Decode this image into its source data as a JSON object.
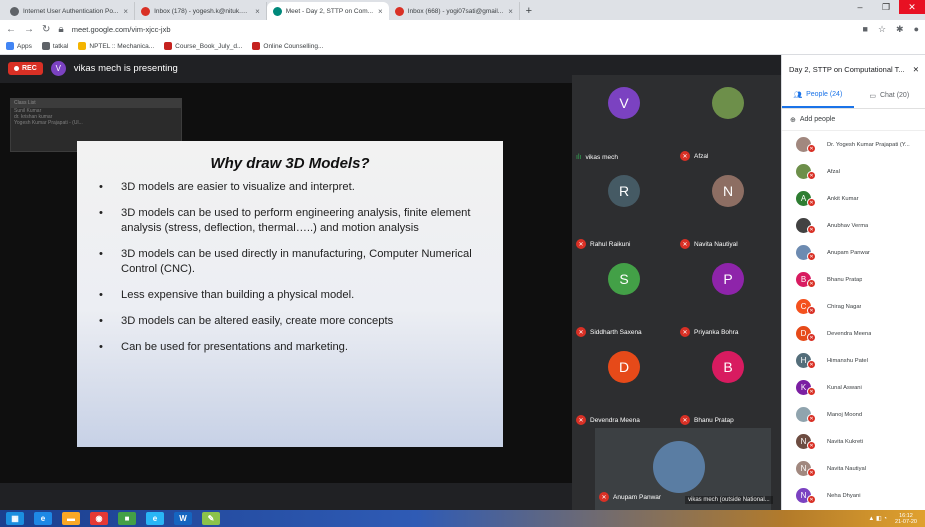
{
  "browser": {
    "tabs": [
      {
        "title": "Internet User Authentication Po...",
        "icon_color": "#5f6368",
        "active": false
      },
      {
        "title": "Inbox (178) - yogesh.k@nituk.ac...",
        "icon_color": "#d93025",
        "active": false
      },
      {
        "title": "Meet - Day 2, STTP on Com...",
        "icon_color": "#00897b",
        "active": true
      },
      {
        "title": "Inbox (668) - yogi07sati@gmail...",
        "icon_color": "#d93025",
        "active": false
      }
    ],
    "new_tab": "+",
    "url": "meet.google.com/vim-xjcc-jxb",
    "bookmarks": [
      {
        "label": "Apps",
        "color": "#4285f4"
      },
      {
        "label": "tatkal",
        "color": "#5f6368"
      },
      {
        "label": "NPTEL :: Mechanica...",
        "color": "#f4b400"
      },
      {
        "label": "Course_Book_July_d...",
        "color": "#c5221f"
      },
      {
        "label": "Online Counselling...",
        "color": "#c5221f"
      }
    ]
  },
  "meeting": {
    "rec_label": "REC",
    "presenter_initial": "V",
    "presenter_text": "vikas mech is presenting",
    "class_list": {
      "header": "Class List",
      "rows": [
        "Sunil Kumar",
        "dr. krishan kumar",
        "Yogesh Kumar Prajapati - (Ul..."
      ]
    },
    "slide": {
      "title": "Why draw 3D Models?",
      "bullets": [
        "3D models are easier to visualize and interpret.",
        "3D models can be used to perform engineering analysis, finite element analysis (stress, deflection, thermal…..) and motion analysis",
        "3D models can be used directly in manufacturing, Computer Numerical Control (CNC).",
        "Less expensive than building a physical model.",
        "3D models can be altered easily, create more concepts",
        "Can be used for presentations and marketing."
      ]
    },
    "tiles": [
      {
        "name": "vikas mech",
        "initial": "V",
        "color": "#7b42c1",
        "speaking": true
      },
      {
        "name": "Afzal",
        "initial": "",
        "color": "#6d8f4a",
        "speaking": false
      },
      {
        "name": "Rahul Raikuni",
        "initial": "R",
        "color": "#455a64",
        "speaking": false
      },
      {
        "name": "Navita Nautiyal",
        "initial": "N",
        "color": "#8d6e63",
        "speaking": false
      },
      {
        "name": "Siddharth Saxena",
        "initial": "S",
        "color": "#43a047",
        "speaking": false
      },
      {
        "name": "Priyanka Bohra",
        "initial": "P",
        "color": "#8e24aa",
        "speaking": false
      },
      {
        "name": "Devendra Meena",
        "initial": "D",
        "color": "#e64a19",
        "speaking": false
      },
      {
        "name": "Bhanu Pratap",
        "initial": "B",
        "color": "#d81b60",
        "speaking": false
      }
    ],
    "self_tile_name": "Anupam Panwar",
    "self_tile_label": "vikas mech (outside National..."
  },
  "panel": {
    "title": "Day 2, STTP on Computational T...",
    "tab_people": "People (24)",
    "tab_chat": "Chat (20)",
    "add_people": "Add people",
    "people": [
      {
        "name": "Dr. Yogesh Kumar Prajapati (Y...",
        "initial": "",
        "color": "#a1887f"
      },
      {
        "name": "Afzal",
        "initial": "",
        "color": "#6d8f4a"
      },
      {
        "name": "Ankit Kumar",
        "initial": "A",
        "color": "#2e7d32"
      },
      {
        "name": "Anubhav Verma",
        "initial": "",
        "color": "#424242"
      },
      {
        "name": "Anupam Panwar",
        "initial": "",
        "color": "#6d8bb1"
      },
      {
        "name": "Bhanu Pratap",
        "initial": "B",
        "color": "#d81b60"
      },
      {
        "name": "Chirag Nagar",
        "initial": "C",
        "color": "#f4511e"
      },
      {
        "name": "Devendra Meena",
        "initial": "D",
        "color": "#e64a19"
      },
      {
        "name": "Himanshu Patel",
        "initial": "H",
        "color": "#546e7a"
      },
      {
        "name": "Kunal Aswani",
        "initial": "K",
        "color": "#7b1fa2"
      },
      {
        "name": "Manoj Moond",
        "initial": "",
        "color": "#90a4ae"
      },
      {
        "name": "Navita Kukreti",
        "initial": "N",
        "color": "#6d4c41"
      },
      {
        "name": "Navita Nautiyal",
        "initial": "N",
        "color": "#a1887f"
      },
      {
        "name": "Neha Dhyani",
        "initial": "N",
        "color": "#7b42c1"
      }
    ]
  },
  "taskbar": {
    "apps": [
      {
        "icon": "windows-icon",
        "color": "#1b8fe0",
        "glyph": "▦"
      },
      {
        "icon": "ie-icon",
        "color": "#1e88e5",
        "glyph": "e"
      },
      {
        "icon": "folder-icon",
        "color": "#f9a825",
        "glyph": "▬"
      },
      {
        "icon": "chrome-icon",
        "color": "#e53935",
        "glyph": "◉"
      },
      {
        "icon": "app-icon",
        "color": "#43a047",
        "glyph": "■"
      },
      {
        "icon": "edge-icon",
        "color": "#29b6f6",
        "glyph": "e"
      },
      {
        "icon": "word-icon",
        "color": "#1565c0",
        "glyph": "W"
      },
      {
        "icon": "paint-icon",
        "color": "#8bc34a",
        "glyph": "✎"
      }
    ],
    "time": "16:12",
    "date": "21-07-20"
  }
}
